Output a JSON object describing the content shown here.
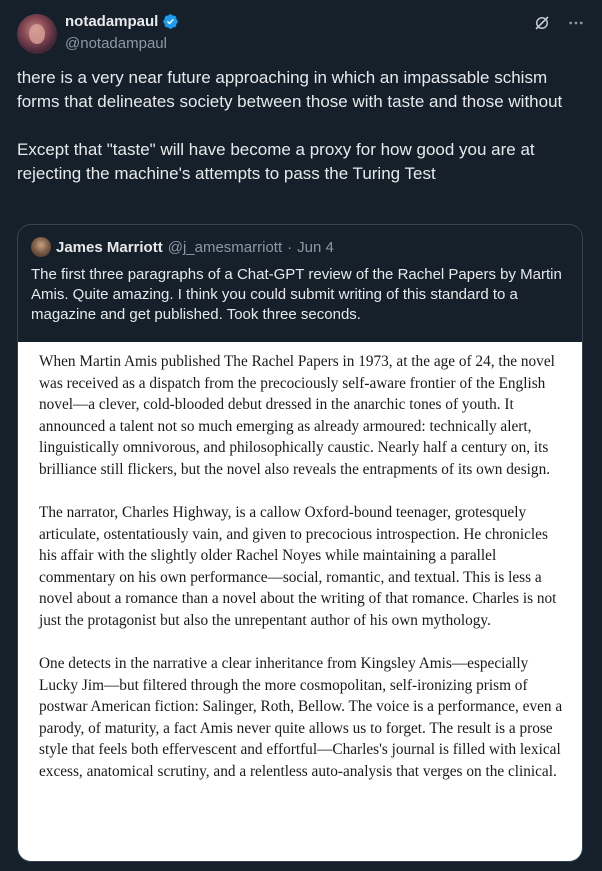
{
  "author": {
    "name": "notadampaul",
    "handle": "@notadampaul",
    "avatar_icon": "avatar-photo",
    "verified_icon": "verified-badge-icon",
    "verified_color": "#1d9bf0"
  },
  "header_icons": [
    "grok-icon",
    "more-icon"
  ],
  "tweet": {
    "text": "there is a very near future approaching in which an impassable schism forms that delineates society between those with taste and those without\n\nExcept that \"taste\" will have become a proxy for how good you are at rejecting the machine's attempts to pass the Turing Test"
  },
  "quote": {
    "name": "James Marriott",
    "handle": "@j_amesmarriott",
    "separator": "·",
    "date": "Jun 4",
    "text": "The first three paragraphs of a Chat-GPT review of the Rachel Papers by Martin Amis. Quite amazing. I think you could submit writing of this standard to a magazine and get published. Took three seconds.",
    "image_paragraphs": [
      "When Martin Amis published The Rachel Papers in 1973, at the age of 24, the novel was received as a dispatch from the precociously self-aware frontier of the English novel—a clever, cold-blooded debut dressed in the anarchic tones of youth. It announced a talent not so much emerging as already armoured: technically alert, linguistically omnivorous, and philosophically caustic. Nearly half a century on, its brilliance still flickers, but the novel also reveals the entrapments of its own design.",
      "The narrator, Charles Highway, is a callow Oxford-bound teenager, grotesquely articulate, ostentatiously vain, and given to precocious introspection. He chronicles his affair with the slightly older Rachel Noyes while maintaining a parallel commentary on his own performance—social, romantic, and textual. This is less a novel about a romance than a novel about the writing of that romance. Charles is not just the protagonist but also the unrepentant author of his own mythology.",
      "One detects in the narrative a clear inheritance from Kingsley Amis—especially Lucky Jim—but filtered through the more cosmopolitan, self-ironizing prism of postwar American fiction: Salinger, Roth, Bellow. The voice is a performance, even a parody, of maturity, a fact Amis never quite allows us to forget. The result is a prose style that feels both effervescent and effortful—Charles's journal is filled with lexical excess, anatomical scrutiny, and a relentless auto-analysis that verges on the clinical."
    ]
  },
  "colors": {
    "background": "#15202b",
    "text_primary": "#e7e9ea",
    "text_secondary": "#8b98a5",
    "border": "#38444d"
  }
}
